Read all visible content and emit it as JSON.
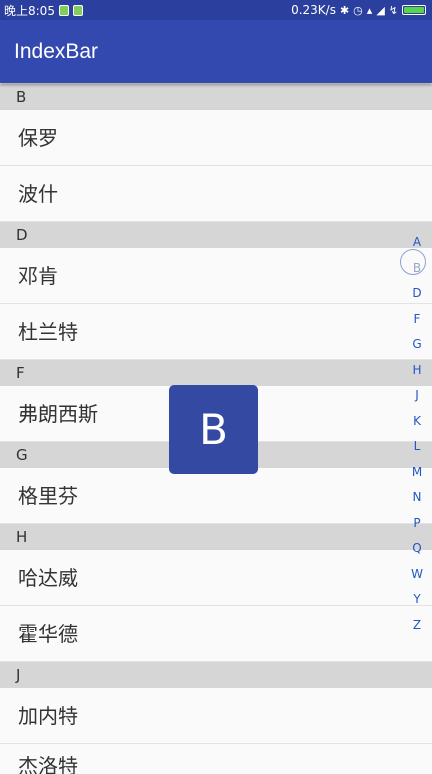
{
  "status_bar": {
    "time": "晚上8:05",
    "net_speed": "0.23K/s",
    "icons": [
      "sim-icon",
      "notification-icon",
      "bluetooth-icon",
      "alarm-icon",
      "wifi-icon",
      "signal-icon",
      "charging-icon",
      "battery-icon"
    ],
    "battery_fraction": 1.0
  },
  "app_bar": {
    "title": "IndexBar",
    "color": "#3449b0"
  },
  "list": {
    "sections": [
      {
        "header": "B",
        "items": [
          "保罗",
          "波什"
        ]
      },
      {
        "header": "D",
        "items": [
          "邓肯",
          "杜兰特"
        ]
      },
      {
        "header": "F",
        "items": [
          "弗朗西斯"
        ]
      },
      {
        "header": "G",
        "items": [
          "格里芬"
        ]
      },
      {
        "header": "H",
        "items": [
          "哈达威",
          "霍华德"
        ]
      },
      {
        "header": "J",
        "items": [
          "加内特",
          "杰洛特"
        ]
      }
    ]
  },
  "index_bar": {
    "letters": [
      "A",
      "B",
      "D",
      "F",
      "G",
      "H",
      "J",
      "K",
      "L",
      "M",
      "N",
      "P",
      "Q",
      "W",
      "Y",
      "Z"
    ],
    "active": "B",
    "color": "#2257c4"
  },
  "overlay": {
    "letter": "B"
  }
}
